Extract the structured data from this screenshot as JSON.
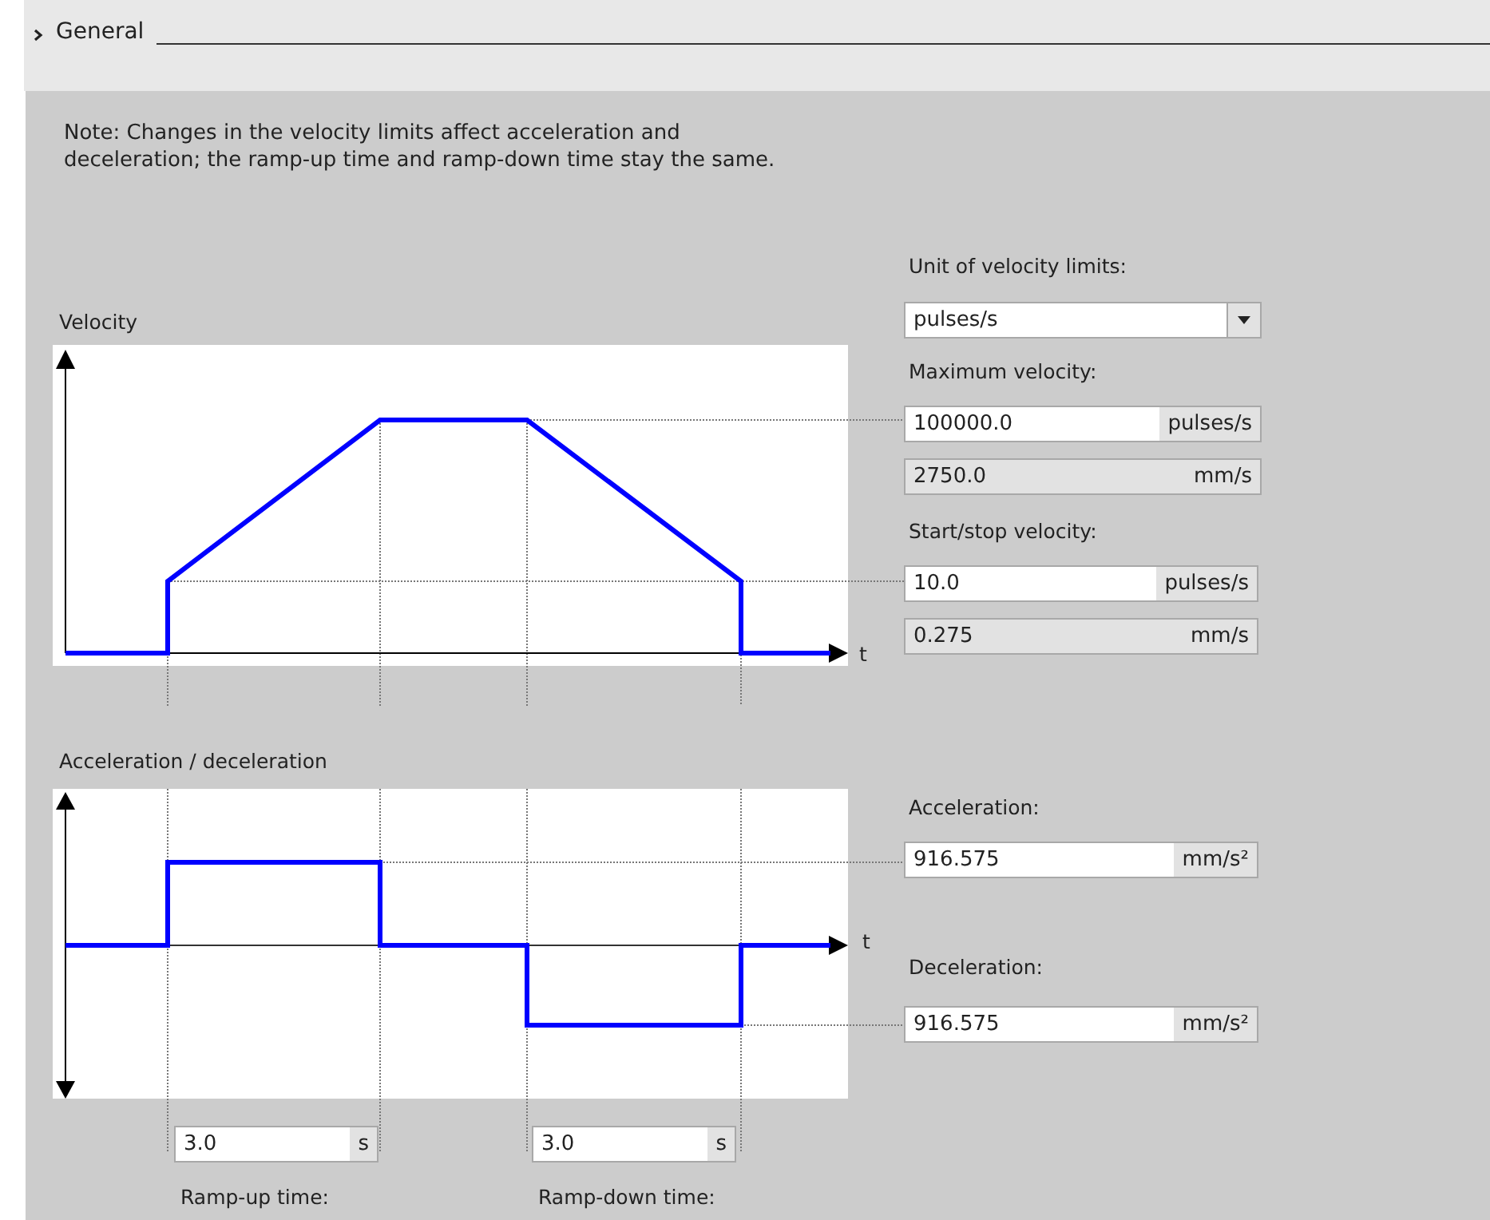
{
  "section": {
    "title": "General"
  },
  "note": "Note: Changes in the velocity limits affect acceleration and deceleration; the ramp-up time and ramp-down time stay the same.",
  "velocity_chart": {
    "title": "Velocity",
    "axis_label": "t"
  },
  "acceleration_chart": {
    "title": "Acceleration / deceleration",
    "axis_label": "t"
  },
  "unit_select": {
    "label": "Unit of velocity limits:",
    "value": "pulses/s"
  },
  "max_velocity": {
    "label": "Maximum velocity:",
    "value": "100000.0",
    "unit": "pulses/s",
    "converted_value": "2750.0",
    "converted_unit": "mm/s"
  },
  "start_stop_velocity": {
    "label": "Start/stop velocity:",
    "value": "10.0",
    "unit": "pulses/s",
    "converted_value": "0.275",
    "converted_unit": "mm/s"
  },
  "acceleration": {
    "label": "Acceleration:",
    "value": "916.575",
    "unit": "mm/s²"
  },
  "deceleration": {
    "label": "Deceleration:",
    "value": "916.575",
    "unit": "mm/s²"
  },
  "ramp_up_time": {
    "label": "Ramp-up time:",
    "value": "3.0",
    "unit": "s"
  },
  "ramp_down_time": {
    "label": "Ramp-down time:",
    "value": "3.0",
    "unit": "s"
  }
}
